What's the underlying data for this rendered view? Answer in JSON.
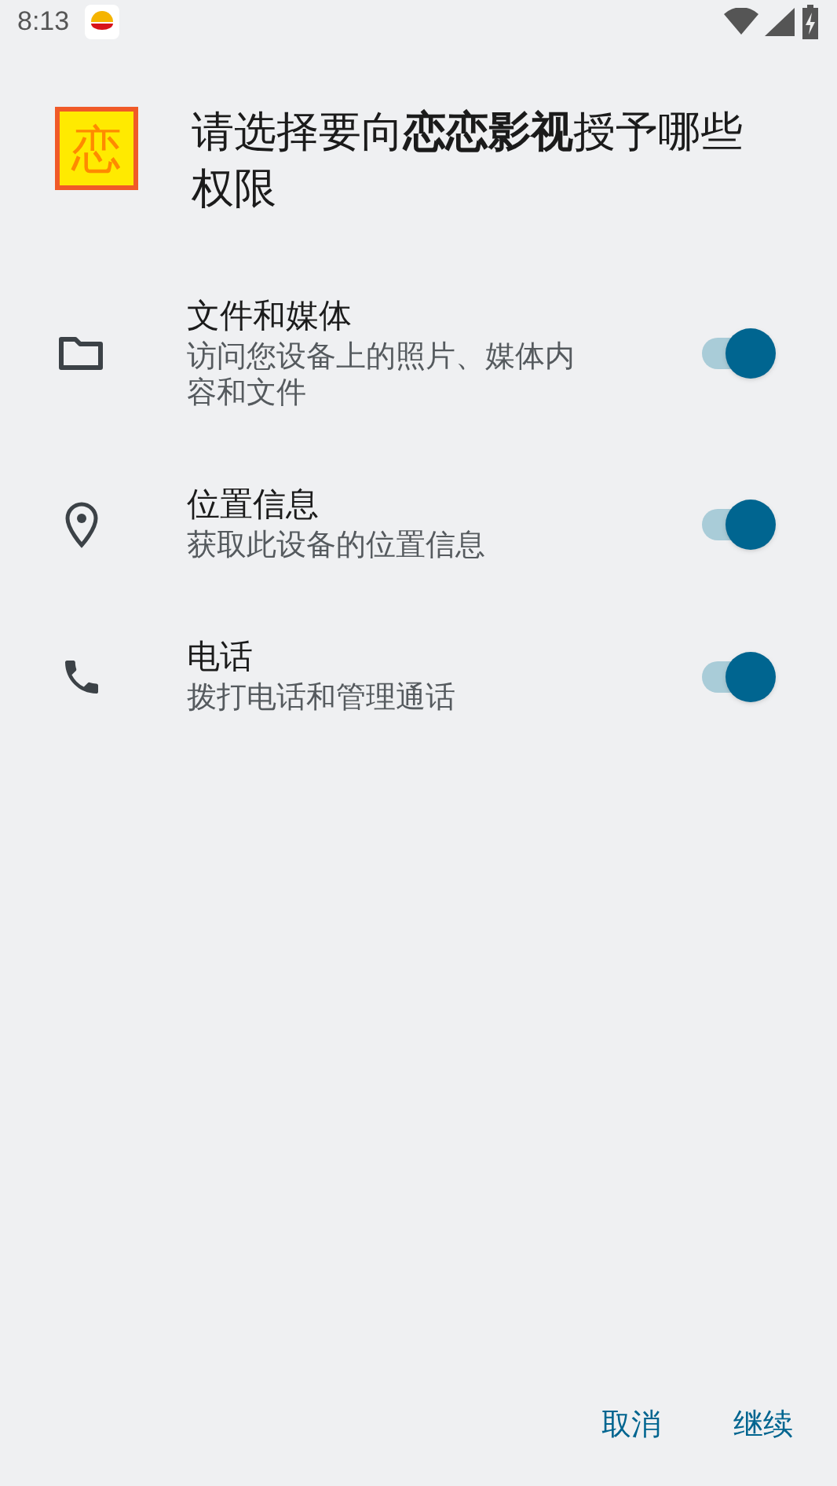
{
  "status_bar": {
    "time": "8:13"
  },
  "header": {
    "app_icon_text": "恋",
    "title": "请选择要向**恋恋影视**授予哪些权限"
  },
  "permissions": [
    {
      "kind": "folder",
      "name": "文件和媒体",
      "description": "访问您设备上的照片、媒体内容和文件",
      "on": true
    },
    {
      "kind": "location",
      "name": "位置信息",
      "description": "获取此设备的位置信息",
      "on": true
    },
    {
      "kind": "phone",
      "name": "电话",
      "description": "拨打电话和管理通话",
      "on": true
    }
  ],
  "buttons": [
    "取消",
    "继续"
  ]
}
